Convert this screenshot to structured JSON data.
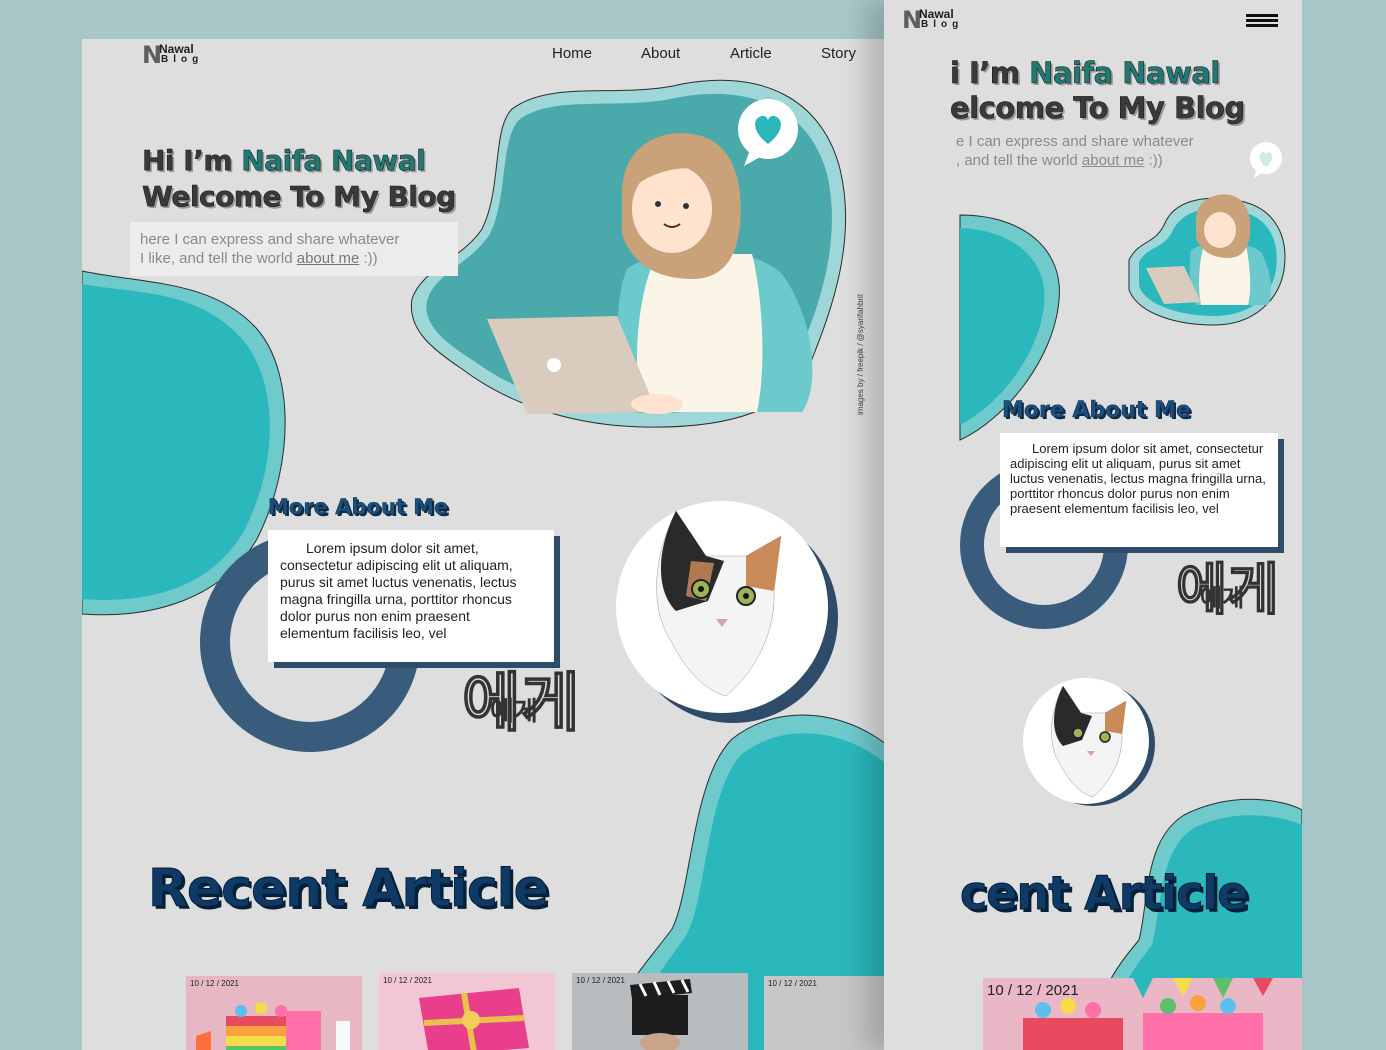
{
  "logo": {
    "letter": "N",
    "line1": "Nawal",
    "line2": "Blog"
  },
  "nav": {
    "items": [
      "Home",
      "About",
      "Article",
      "Story"
    ]
  },
  "hero": {
    "line1_a": "Hi I’m ",
    "line1_b": "Naifa Nawal",
    "line2": "Welcome To My Blog",
    "sub_a": "here I can express and share whatever",
    "sub_b": "I like, and tell the world ",
    "sub_link": "about me",
    "sub_c": " :))",
    "credit": "images by / freepik / @syarifahbrit"
  },
  "about": {
    "title": "More About Me",
    "text": "Lorem ipsum dolor sit amet, consectetur adipiscing elit ut aliquam, purus sit amet luctus venenatis, lectus magna fringilla urna, porttitor rhoncus dolor purus non enim praesent elementum facilisis leo, vel",
    "korean": "에게"
  },
  "articles": {
    "title": "Recent Article",
    "cards": [
      {
        "date": "10 / 12 / 2021",
        "kind": "cake"
      },
      {
        "date": "10 / 12 / 2021",
        "kind": "gift"
      },
      {
        "date": "10 / 12 / 2021",
        "kind": "clapper"
      },
      {
        "date": "10 / 12 / 2021",
        "kind": "blank"
      }
    ]
  },
  "mobile": {
    "hero_line1_a": "i I’m ",
    "hero_line1_b": "Naifa Nawal",
    "hero_line2": "elcome To My Blog",
    "sub_a": "e I can express and share whatever",
    "sub_b": ", and tell the world ",
    "sub_link": "about me",
    "sub_c": " :))",
    "about_title": "More About Me",
    "about_text": "Lorem ipsum dolor sit amet, consectetur adipiscing elit ut aliquam, purus sit amet luctus venenatis, lectus magna fringilla urna, porttitor rhoncus dolor purus non enim praesent elementum facilisis leo, vel",
    "korean": "에게",
    "articles_title": "cent Article",
    "card_date": "10 / 12 / 2021"
  },
  "colors": {
    "teal": "#2bb8bd",
    "navy": "#2e4c69",
    "bg": "#dedede"
  }
}
